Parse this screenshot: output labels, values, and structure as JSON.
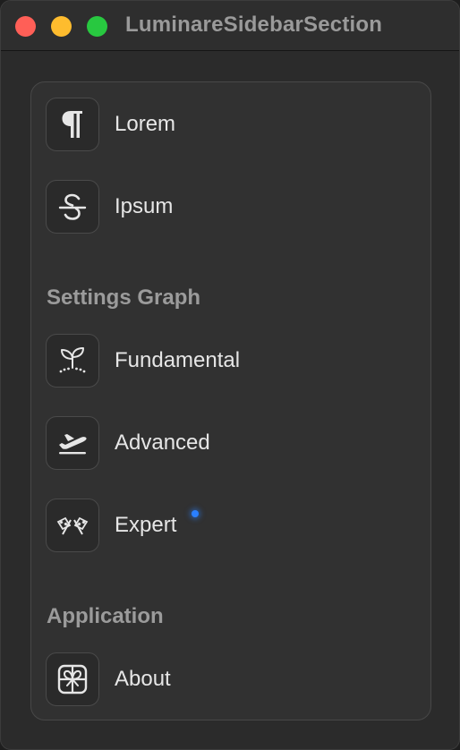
{
  "window": {
    "title": "LuminareSidebarSection"
  },
  "sidebar": {
    "top_items": [
      {
        "label": "Lorem",
        "icon": "pilcrow-icon"
      },
      {
        "label": "Ipsum",
        "icon": "strikethrough-icon"
      }
    ],
    "sections": [
      {
        "header": "Settings Graph",
        "items": [
          {
            "label": "Fundamental",
            "icon": "sprout-icon"
          },
          {
            "label": "Advanced",
            "icon": "airplane-departure-icon"
          },
          {
            "label": "Expert",
            "icon": "checkered-flags-icon"
          }
        ]
      },
      {
        "header": "Application",
        "items": [
          {
            "label": "About",
            "icon": "gift-icon"
          }
        ]
      }
    ]
  },
  "colors": {
    "accent_dot": "#2a7fff",
    "close": "#ff5f57",
    "minimize": "#febc2e",
    "zoom": "#28c840"
  }
}
